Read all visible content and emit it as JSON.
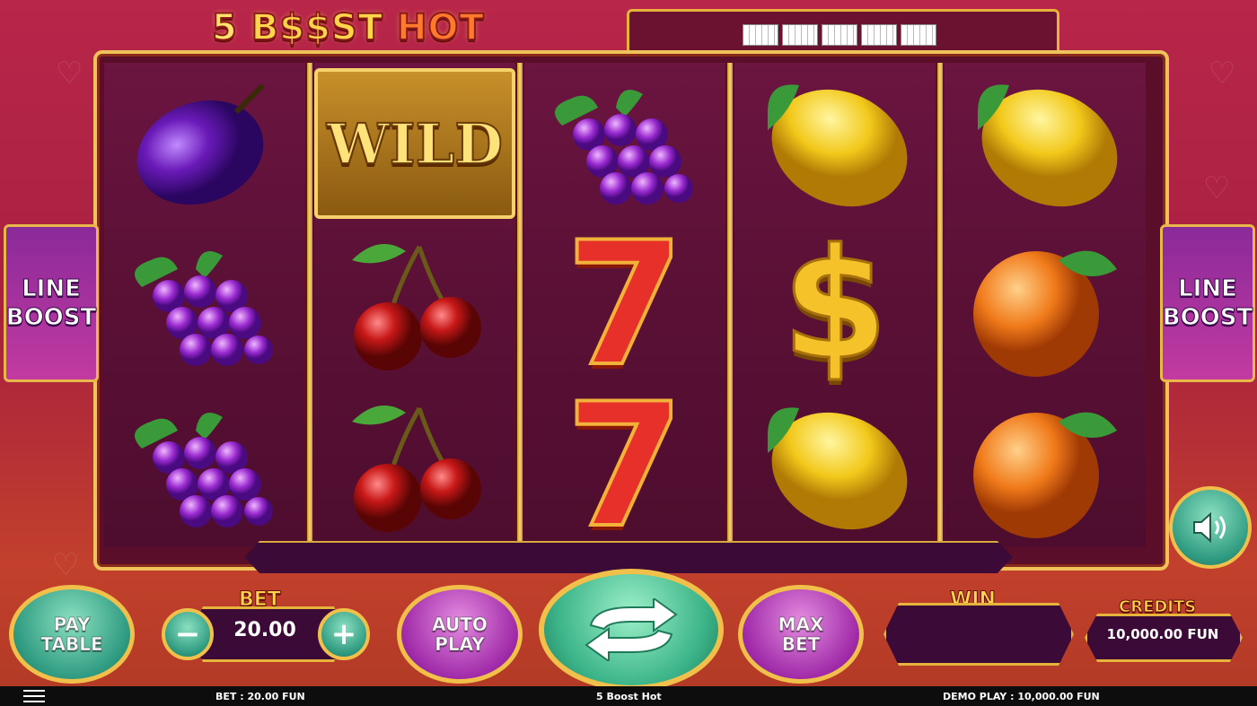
{
  "game": {
    "logo_number": "5",
    "logo_boost": "B$$ST",
    "logo_hot": "HOT"
  },
  "reels": [
    [
      "plum",
      "grapes",
      "grapes"
    ],
    [
      "wild",
      "cherries",
      "cherries"
    ],
    [
      "grapes",
      "seven",
      "seven"
    ],
    [
      "lemon",
      "dollar",
      "lemon"
    ],
    [
      "lemon",
      "orange",
      "orange"
    ]
  ],
  "wild_label": "WILD",
  "line_boost": {
    "line1": "LINE",
    "line2": "BOOST"
  },
  "controls": {
    "pay_table": {
      "line1": "PAY",
      "line2": "TABLE"
    },
    "bet_label": "BET",
    "bet_value": "20.00",
    "minus": "−",
    "plus": "+",
    "auto_play": {
      "line1": "AUTO",
      "line2": "PLAY"
    },
    "max_bet": {
      "line1": "MAX",
      "line2": "BET"
    },
    "win_label": "WIN",
    "win_value": "",
    "credits_label": "CREDITS",
    "credits_value": "10,000.00 FUN"
  },
  "footer": {
    "bet": "BET : 20.00 FUN",
    "title": "5 Boost Hot",
    "demo": "DEMO PLAY : 10,000.00 FUN"
  },
  "icons": [
    "menu-icon",
    "sound-icon",
    "spin-icon",
    "payline-icon"
  ],
  "colors": {
    "gold": "#f1c04a",
    "reel_bg": "#5a1035",
    "teal": "#2e9a80",
    "purple": "#a02aa8"
  }
}
